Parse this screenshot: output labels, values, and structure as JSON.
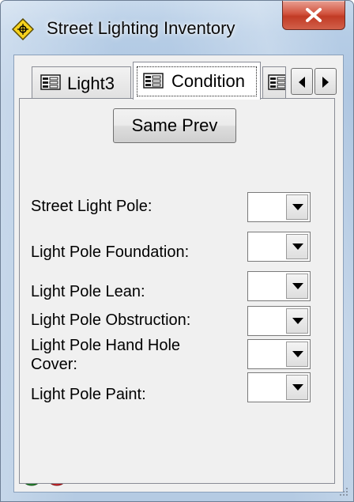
{
  "window": {
    "title": "Street Lighting Inventory",
    "close_label": "X"
  },
  "tabs": [
    {
      "label": "Light3",
      "selected": false
    },
    {
      "label": "Condition",
      "selected": true
    }
  ],
  "panel": {
    "same_prev_label": "Same Prev",
    "fields": [
      {
        "label": "Street Light Pole:",
        "value": ""
      },
      {
        "label": "Light Pole Foundation:",
        "value": ""
      },
      {
        "label": "Light Pole Lean:",
        "value": ""
      },
      {
        "label": "Light Pole Obstruction:",
        "value": ""
      },
      {
        "label": "Light Pole Hand Hole Cover:",
        "value": ""
      },
      {
        "label": "Light Pole Paint:",
        "value": ""
      }
    ]
  },
  "footer": {
    "ok_label": "ok"
  },
  "colors": {
    "ok_green": "#1e8a2a",
    "cancel_red": "#d8262a",
    "close_red": "#c13b25"
  },
  "icons": {
    "app": "diamond-crosshair-icon",
    "tab": "form-icon",
    "ok": "ok-icon",
    "cancel": "cancel-icon"
  }
}
